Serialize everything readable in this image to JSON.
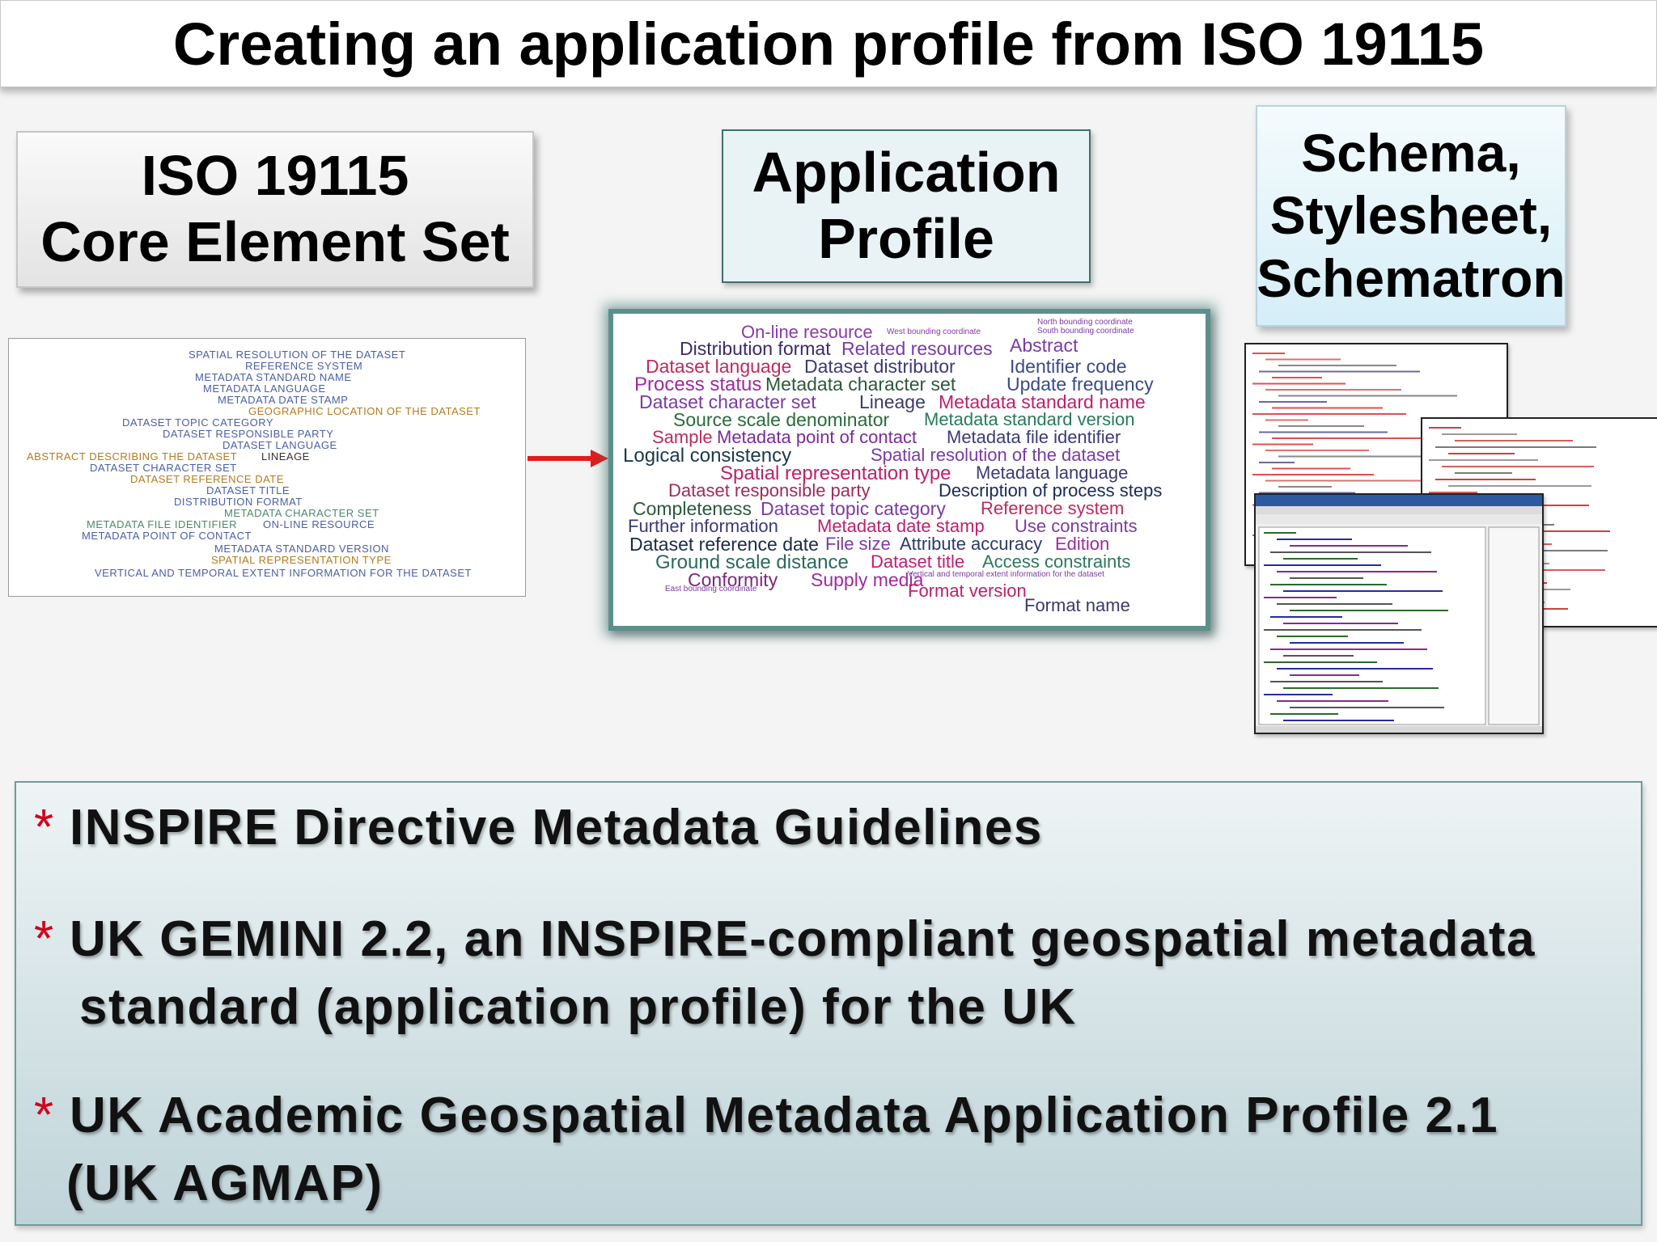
{
  "title": "Creating an application profile from ISO 19115",
  "boxes": {
    "iso": [
      "ISO 19115",
      "Core Element Set"
    ],
    "application": [
      "Application",
      "Profile"
    ],
    "schema": [
      "Schema,",
      "Stylesheet,",
      "Schematron"
    ]
  },
  "iso_terms": [
    {
      "text": "SPATIAL RESOLUTION OF THE DATASET",
      "color": "#4a5fa8"
    },
    {
      "text": "REFERENCE SYSTEM",
      "color": "#4a5fa8"
    },
    {
      "text": "METADATA STANDARD NAME",
      "color": "#4a5fa8"
    },
    {
      "text": "METADATA LANGUAGE",
      "color": "#4a5fa8"
    },
    {
      "text": "METADATA DATE STAMP",
      "color": "#4a5fa8"
    },
    {
      "text": "GEOGRAPHIC LOCATION OF THE DATASET",
      "color": "#b57a1e"
    },
    {
      "text": "DATASET TOPIC CATEGORY",
      "color": "#4a5fa8"
    },
    {
      "text": "DATASET RESPONSIBLE PARTY",
      "color": "#4a5fa8"
    },
    {
      "text": "DATASET LANGUAGE",
      "color": "#4a5fa8"
    },
    {
      "text": "ABSTRACT DESCRIBING THE DATASET",
      "color": "#b57a1e"
    },
    {
      "text": "LINEAGE",
      "color": "#333333"
    },
    {
      "text": "DATASET CHARACTER SET",
      "color": "#4a5fa8"
    },
    {
      "text": "DATASET REFERENCE DATE",
      "color": "#b57a1e"
    },
    {
      "text": "DATASET TITLE",
      "color": "#4a5fa8"
    },
    {
      "text": "DISTRIBUTION FORMAT",
      "color": "#4a5fa8"
    },
    {
      "text": "METADATA CHARACTER SET",
      "color": "#4a8a6a"
    },
    {
      "text": "METADATA FILE IDENTIFIER",
      "color": "#4a8a6a"
    },
    {
      "text": "ON-LINE RESOURCE",
      "color": "#4a5fa8"
    },
    {
      "text": "METADATA POINT OF CONTACT",
      "color": "#4a5fa8"
    },
    {
      "text": "METADATA STANDARD VERSION",
      "color": "#4a5fa8"
    },
    {
      "text": "SPATIAL REPRESENTATION TYPE",
      "color": "#b57a1e"
    },
    {
      "text": "VERTICAL AND TEMPORAL EXTENT INFORMATION FOR THE DATASET",
      "color": "#4a5fa8"
    }
  ],
  "cloud_terms": [
    {
      "text": "On-line resource",
      "color": "#8a3aa8"
    },
    {
      "text": "West bounding coordinate",
      "color": "#8a3aa8"
    },
    {
      "text": "North bounding coordinate",
      "color": "#7a3aa8"
    },
    {
      "text": "South bounding coordinate",
      "color": "#7a3aa8"
    },
    {
      "text": "Distribution format",
      "color": "#3a2a6a"
    },
    {
      "text": "Related resources",
      "color": "#7a3aa8"
    },
    {
      "text": "Abstract",
      "color": "#7a3aa8"
    },
    {
      "text": "Dataset language",
      "color": "#c02a5a"
    },
    {
      "text": "Dataset distributor",
      "color": "#3a3a7a"
    },
    {
      "text": "Identifier code",
      "color": "#3a4a8a"
    },
    {
      "text": "Process status",
      "color": "#a02aa0"
    },
    {
      "text": "Metadata character set",
      "color": "#2a5a3a"
    },
    {
      "text": "Update frequency",
      "color": "#3a4a8a"
    },
    {
      "text": "Dataset character set",
      "color": "#7a3aa8"
    },
    {
      "text": "Lineage",
      "color": "#3a3a6a"
    },
    {
      "text": "Metadata standard name",
      "color": "#c0206a"
    },
    {
      "text": "Source scale denominator",
      "color": "#2a6a3a"
    },
    {
      "text": "Metadata standard version",
      "color": "#2a7a5a"
    },
    {
      "text": "Sample",
      "color": "#c02a5a"
    },
    {
      "text": "Metadata point of contact",
      "color": "#7a2aa0"
    },
    {
      "text": "Metadata file identifier",
      "color": "#3a3a7a"
    },
    {
      "text": "Logical consistency",
      "color": "#1a3a4a"
    },
    {
      "text": "Spatial resolution of the dataset",
      "color": "#7a3aa8"
    },
    {
      "text": "Spatial representation type",
      "color": "#c0206a"
    },
    {
      "text": "Metadata language",
      "color": "#3a3a7a"
    },
    {
      "text": "Dataset responsible party",
      "color": "#a02a5a"
    },
    {
      "text": "Description of process steps",
      "color": "#1a2a5a"
    },
    {
      "text": "Completeness",
      "color": "#2a5a3a"
    },
    {
      "text": "Dataset topic category",
      "color": "#7a3aa8"
    },
    {
      "text": "Reference system",
      "color": "#c02a5a"
    },
    {
      "text": "Further information",
      "color": "#3a3a7a"
    },
    {
      "text": "Metadata date stamp",
      "color": "#c0206a"
    },
    {
      "text": "Use constraints",
      "color": "#7a3aa8"
    },
    {
      "text": "Dataset reference date",
      "color": "#1a2a4a"
    },
    {
      "text": "File size",
      "color": "#7a3aa8"
    },
    {
      "text": "Attribute accuracy",
      "color": "#2a3a6a"
    },
    {
      "text": "Edition",
      "color": "#a02aa0"
    },
    {
      "text": "Ground scale distance",
      "color": "#2a6a5a"
    },
    {
      "text": "Dataset title",
      "color": "#c0206a"
    },
    {
      "text": "Access constraints",
      "color": "#2a7a5a"
    },
    {
      "text": "Conformity",
      "color": "#7a2a7a"
    },
    {
      "text": "Supply media",
      "color": "#a02aa0"
    },
    {
      "text": "Vertical and temporal extent information for the dataset",
      "color": "#7a3aa8"
    },
    {
      "text": "Format version",
      "color": "#c0206a"
    },
    {
      "text": "East bounding coordinate",
      "color": "#7a3aa8"
    },
    {
      "text": "Format name",
      "color": "#3a3a6a"
    }
  ],
  "bullets": [
    {
      "lines": [
        "INSPIRE Directive Metadata Guidelines"
      ]
    },
    {
      "lines": [
        "UK GEMINI 2.2, an INSPIRE-compliant geospatial metadata",
        "standard (application profile) for the UK"
      ]
    },
    {
      "lines": [
        "UK Academic Geospatial Metadata Application Profile 2.1",
        "(UK AGMAP)"
      ]
    }
  ],
  "bullet_marker": "*",
  "colors": {
    "arrow": "#e21b1b",
    "cloud_border": "#5d8f8b",
    "bullet_marker": "#d0021b"
  }
}
